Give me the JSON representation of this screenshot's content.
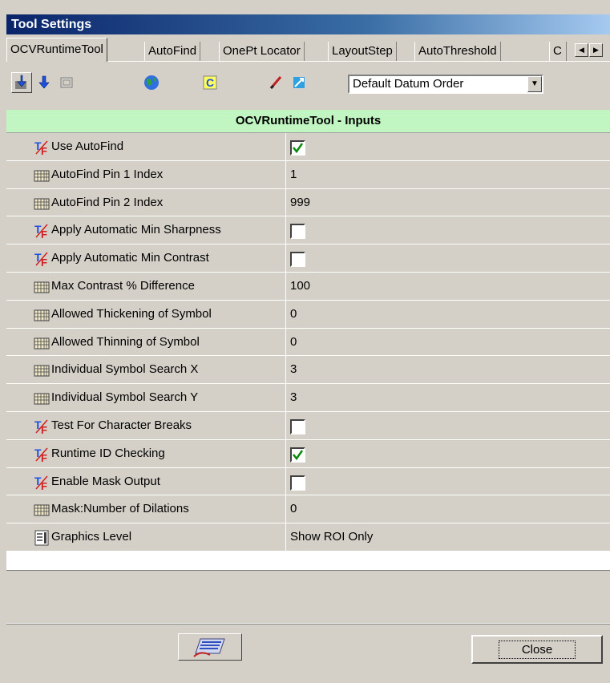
{
  "window": {
    "title": "Tool Settings"
  },
  "tabs": [
    {
      "label": "OCVRuntimeTool",
      "active": true
    },
    {
      "label": "AutoFind"
    },
    {
      "label": "OnePt Locator"
    },
    {
      "label": "LayoutStep"
    },
    {
      "label": "AutoThreshold"
    },
    {
      "label": "C"
    }
  ],
  "toolbar": {
    "datum_order": "Default Datum Order"
  },
  "grid": {
    "header": "OCVRuntimeTool - Inputs",
    "rows": [
      {
        "label": "Use AutoFind",
        "type": "bool",
        "checked": true,
        "icon": "true-false-icon"
      },
      {
        "label": "AutoFind Pin 1 Index",
        "type": "number",
        "value": "1",
        "icon": "numeric-icon"
      },
      {
        "label": "AutoFind Pin 2 Index",
        "type": "number",
        "value": "999",
        "icon": "numeric-icon"
      },
      {
        "label": "Apply Automatic Min Sharpness",
        "type": "bool",
        "checked": false,
        "icon": "true-false-icon"
      },
      {
        "label": "Apply Automatic Min Contrast",
        "type": "bool",
        "checked": false,
        "icon": "true-false-icon"
      },
      {
        "label": "Max Contrast % Difference",
        "type": "number",
        "value": "100",
        "icon": "numeric-icon"
      },
      {
        "label": "Allowed Thickening of Symbol",
        "type": "number",
        "value": "0",
        "icon": "numeric-icon"
      },
      {
        "label": "Allowed Thinning of Symbol",
        "type": "number",
        "value": "0",
        "icon": "numeric-icon"
      },
      {
        "label": "Individual Symbol Search X",
        "type": "number",
        "value": "3",
        "icon": "numeric-icon"
      },
      {
        "label": "Individual Symbol Search Y",
        "type": "number",
        "value": "3",
        "icon": "numeric-icon"
      },
      {
        "label": "Test For Character Breaks",
        "type": "bool",
        "checked": false,
        "icon": "true-false-icon"
      },
      {
        "label": "Runtime ID Checking",
        "type": "bool",
        "checked": true,
        "icon": "true-false-icon"
      },
      {
        "label": "Enable Mask Output",
        "type": "bool",
        "checked": false,
        "icon": "true-false-icon"
      },
      {
        "label": "Mask:Number of Dilations",
        "type": "number",
        "value": "0",
        "icon": "numeric-icon"
      },
      {
        "label": "Graphics Level",
        "type": "list",
        "value": "Show ROI Only",
        "icon": "list-icon"
      }
    ]
  },
  "footer": {
    "close_label": "Close"
  }
}
